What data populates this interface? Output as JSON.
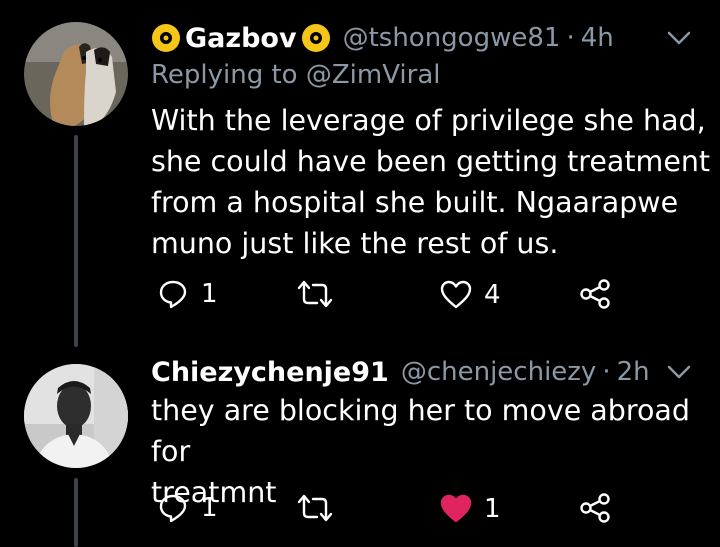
{
  "tweets": [
    {
      "display_name": "Gazbov",
      "handle": "@tshongogwe81",
      "dot": "·",
      "time": "4h",
      "reply_to_prefix": "Replying to",
      "reply_to_handle": "@ZimViral",
      "body_lines": [
        "With the leverage of privilege she had,",
        "she could have been getting treatment",
        "from a hospital she built. Ngaarapwe",
        "muno just like the rest of us."
      ],
      "reply_count": "1",
      "like_count": "4",
      "liked": false
    },
    {
      "display_name": "Chiezychenje91",
      "handle": "@chenjechiezy",
      "dot": "·",
      "time": "2h",
      "body_lines": [
        "they are blocking her to move abroad for",
        "treatmnt"
      ],
      "reply_count": "1",
      "like_count": "1",
      "liked": true
    }
  ],
  "colors": {
    "background": "#000000",
    "text": "#ffffff",
    "secondary": "#8b98a5",
    "thread_line": "#3d4249",
    "like_active": "#e0245e",
    "badge": "#f5c518"
  },
  "icons": [
    "badge-icon",
    "chevron-down-icon",
    "reply-icon",
    "retweet-icon",
    "like-icon",
    "share-icon"
  ]
}
